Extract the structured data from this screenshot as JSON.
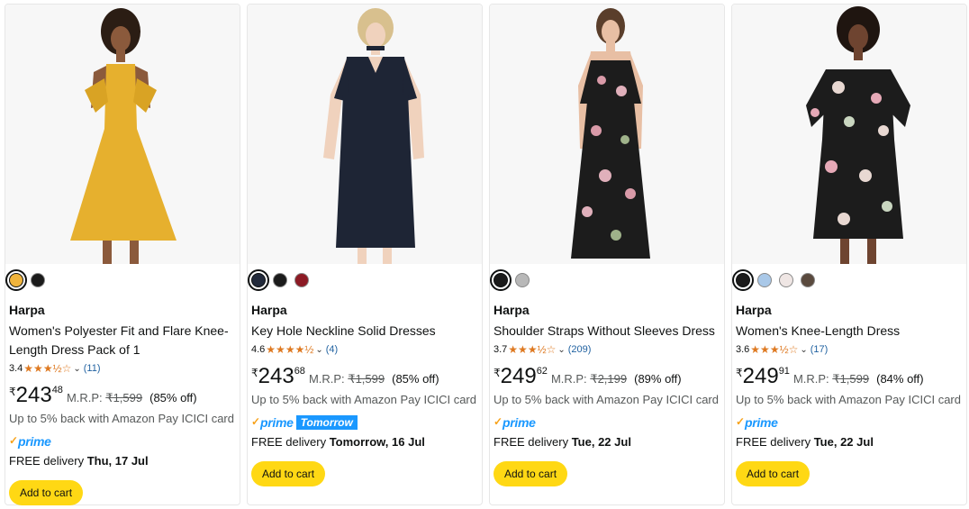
{
  "products": [
    {
      "swatches": [
        "#f0b43c",
        "#1b1b1b"
      ],
      "brand": "Harpa",
      "title": "Women's Polyester Fit and Flare Knee-Length Dress Pack of 1",
      "rating": "3.4",
      "stars": "★★★½☆",
      "reviews": "(11)",
      "currency": "₹",
      "price_whole": "243",
      "price_fraction": "48",
      "mrp_label": "M.R.P:",
      "mrp": "₹1,599",
      "discount": "(85% off)",
      "cashback": "Up to 5% back with Amazon Pay ICICI card",
      "prime": "prime",
      "prime_badge": "",
      "delivery_prefix": "FREE delivery",
      "delivery_date": "Thu, 17 Jul",
      "cta": "Add to cart"
    },
    {
      "swatches": [
        "#222a3b",
        "#1b1b1b",
        "#8c1a24"
      ],
      "brand": "Harpa",
      "title": "Key Hole Neckline Solid Dresses",
      "rating": "4.6",
      "stars": "★★★★½",
      "reviews": "(4)",
      "currency": "₹",
      "price_whole": "243",
      "price_fraction": "68",
      "mrp_label": "M.R.P:",
      "mrp": "₹1,599",
      "discount": "(85% off)",
      "cashback": "Up to 5% back with Amazon Pay ICICI card",
      "prime": "prime",
      "prime_badge": "Tomorrow",
      "delivery_prefix": "FREE delivery",
      "delivery_date": "Tomorrow, 16 Jul",
      "cta": "Add to cart"
    },
    {
      "swatches": [
        "#1b1b1b",
        "#b8b8b8"
      ],
      "brand": "Harpa",
      "title": "Shoulder Straps Without Sleeves Dress",
      "rating": "3.7",
      "stars": "★★★½☆",
      "reviews": "(209)",
      "currency": "₹",
      "price_whole": "249",
      "price_fraction": "62",
      "mrp_label": "M.R.P:",
      "mrp": "₹2,199",
      "discount": "(89% off)",
      "cashback": "Up to 5% back with Amazon Pay ICICI card",
      "prime": "prime",
      "prime_badge": "",
      "delivery_prefix": "FREE delivery",
      "delivery_date": "Tue, 22 Jul",
      "cta": "Add to cart"
    },
    {
      "swatches": [
        "#1b1b1b",
        "#a9c8e8",
        "#efe6e4",
        "#5a4a3e"
      ],
      "brand": "Harpa",
      "title": "Women's Knee-Length Dress",
      "rating": "3.6",
      "stars": "★★★½☆",
      "reviews": "(17)",
      "currency": "₹",
      "price_whole": "249",
      "price_fraction": "91",
      "mrp_label": "M.R.P:",
      "mrp": "₹1,599",
      "discount": "(84% off)",
      "cashback": "Up to 5% back with Amazon Pay ICICI card",
      "prime": "prime",
      "prime_badge": "",
      "delivery_prefix": "FREE delivery",
      "delivery_date": "Tue, 22 Jul",
      "cta": "Add to cart"
    }
  ],
  "colors": {
    "star": "#de7921",
    "prime": "#1a98ff",
    "button": "#ffd814",
    "link": "#2162a1"
  },
  "icons": {
    "rating_dropdown": "chevron-down-icon",
    "prime_check": "prime-check-icon"
  }
}
